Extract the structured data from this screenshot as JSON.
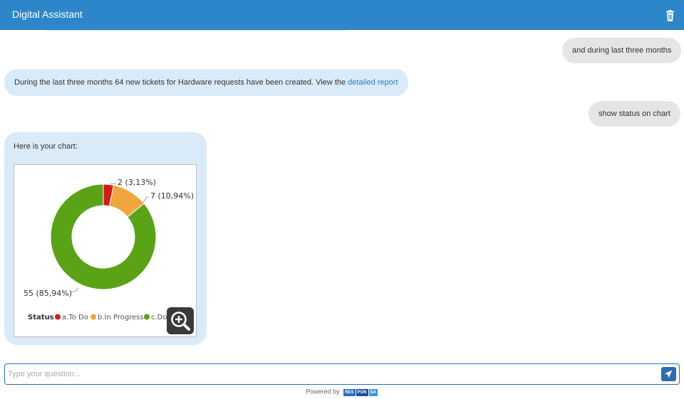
{
  "header": {
    "title": "Digital Assistant",
    "trash_icon": "trash-icon"
  },
  "messages": [
    {
      "from": "user",
      "text": "and during last three months"
    },
    {
      "from": "bot",
      "text": "During the last three months 64 new tickets for Hardware requests have been created. View the ",
      "link": "detailed report"
    },
    {
      "from": "user",
      "text": "show status on chart"
    },
    {
      "from": "bot",
      "text": "Here is your chart:"
    }
  ],
  "chart_data": {
    "type": "pie",
    "style": "donut",
    "categories": [
      "a.To Do",
      "b.In Progress",
      "c.Done"
    ],
    "legend_visible": [
      "a.To Do",
      "b.In Progress",
      "c.Do"
    ],
    "values": [
      2,
      7,
      55
    ],
    "data_labels": [
      "2 (3,13%)",
      "7 (10,94%)",
      "55 (85,94%)"
    ],
    "colors": [
      "#d7191c",
      "#f0a63c",
      "#5aa316"
    ],
    "legend_title": "Status",
    "legend_position": "bottom"
  },
  "zoom_icon": "zoom-in-icon",
  "input": {
    "placeholder": "Type your question...",
    "send_icon": "send-icon"
  },
  "footer": {
    "powered_by": "Powered by",
    "logo": [
      "RES",
      "PON",
      "SA"
    ],
    "logo_colors": [
      "#2e6cc0",
      "#1f4f9a",
      "#3a9ad9"
    ]
  }
}
